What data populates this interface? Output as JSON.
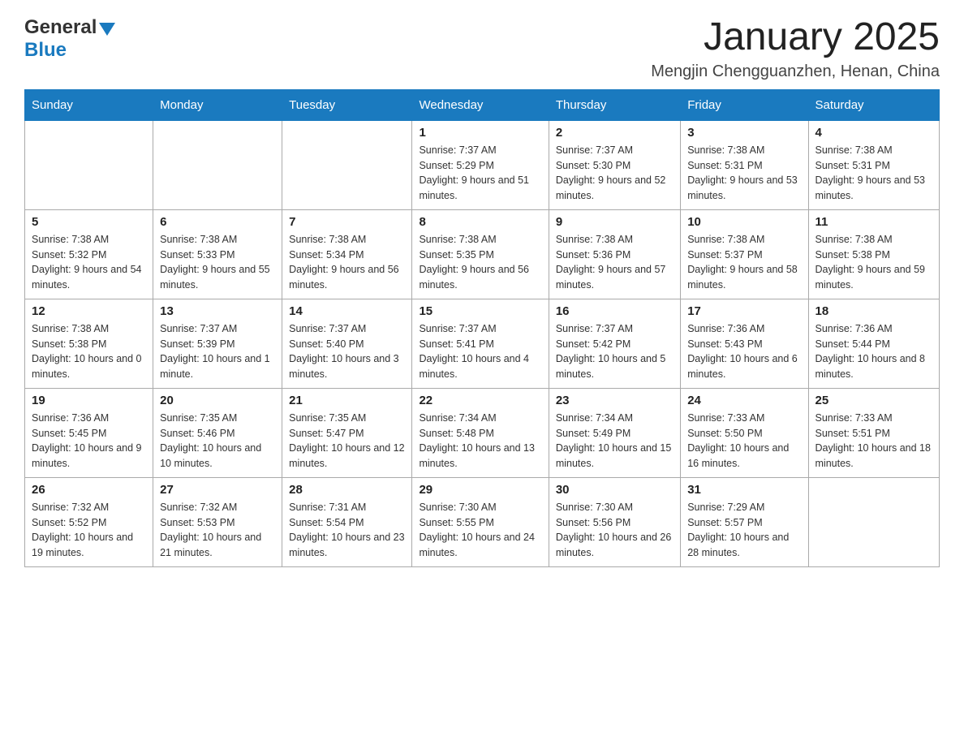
{
  "header": {
    "logo_general": "General",
    "logo_blue": "Blue",
    "month_title": "January 2025",
    "location": "Mengjin Chengguanzhen, Henan, China"
  },
  "days_of_week": [
    "Sunday",
    "Monday",
    "Tuesday",
    "Wednesday",
    "Thursday",
    "Friday",
    "Saturday"
  ],
  "weeks": [
    [
      {
        "day": "",
        "sunrise": "",
        "sunset": "",
        "daylight": ""
      },
      {
        "day": "",
        "sunrise": "",
        "sunset": "",
        "daylight": ""
      },
      {
        "day": "",
        "sunrise": "",
        "sunset": "",
        "daylight": ""
      },
      {
        "day": "1",
        "sunrise": "Sunrise: 7:37 AM",
        "sunset": "Sunset: 5:29 PM",
        "daylight": "Daylight: 9 hours and 51 minutes."
      },
      {
        "day": "2",
        "sunrise": "Sunrise: 7:37 AM",
        "sunset": "Sunset: 5:30 PM",
        "daylight": "Daylight: 9 hours and 52 minutes."
      },
      {
        "day": "3",
        "sunrise": "Sunrise: 7:38 AM",
        "sunset": "Sunset: 5:31 PM",
        "daylight": "Daylight: 9 hours and 53 minutes."
      },
      {
        "day": "4",
        "sunrise": "Sunrise: 7:38 AM",
        "sunset": "Sunset: 5:31 PM",
        "daylight": "Daylight: 9 hours and 53 minutes."
      }
    ],
    [
      {
        "day": "5",
        "sunrise": "Sunrise: 7:38 AM",
        "sunset": "Sunset: 5:32 PM",
        "daylight": "Daylight: 9 hours and 54 minutes."
      },
      {
        "day": "6",
        "sunrise": "Sunrise: 7:38 AM",
        "sunset": "Sunset: 5:33 PM",
        "daylight": "Daylight: 9 hours and 55 minutes."
      },
      {
        "day": "7",
        "sunrise": "Sunrise: 7:38 AM",
        "sunset": "Sunset: 5:34 PM",
        "daylight": "Daylight: 9 hours and 56 minutes."
      },
      {
        "day": "8",
        "sunrise": "Sunrise: 7:38 AM",
        "sunset": "Sunset: 5:35 PM",
        "daylight": "Daylight: 9 hours and 56 minutes."
      },
      {
        "day": "9",
        "sunrise": "Sunrise: 7:38 AM",
        "sunset": "Sunset: 5:36 PM",
        "daylight": "Daylight: 9 hours and 57 minutes."
      },
      {
        "day": "10",
        "sunrise": "Sunrise: 7:38 AM",
        "sunset": "Sunset: 5:37 PM",
        "daylight": "Daylight: 9 hours and 58 minutes."
      },
      {
        "day": "11",
        "sunrise": "Sunrise: 7:38 AM",
        "sunset": "Sunset: 5:38 PM",
        "daylight": "Daylight: 9 hours and 59 minutes."
      }
    ],
    [
      {
        "day": "12",
        "sunrise": "Sunrise: 7:38 AM",
        "sunset": "Sunset: 5:38 PM",
        "daylight": "Daylight: 10 hours and 0 minutes."
      },
      {
        "day": "13",
        "sunrise": "Sunrise: 7:37 AM",
        "sunset": "Sunset: 5:39 PM",
        "daylight": "Daylight: 10 hours and 1 minute."
      },
      {
        "day": "14",
        "sunrise": "Sunrise: 7:37 AM",
        "sunset": "Sunset: 5:40 PM",
        "daylight": "Daylight: 10 hours and 3 minutes."
      },
      {
        "day": "15",
        "sunrise": "Sunrise: 7:37 AM",
        "sunset": "Sunset: 5:41 PM",
        "daylight": "Daylight: 10 hours and 4 minutes."
      },
      {
        "day": "16",
        "sunrise": "Sunrise: 7:37 AM",
        "sunset": "Sunset: 5:42 PM",
        "daylight": "Daylight: 10 hours and 5 minutes."
      },
      {
        "day": "17",
        "sunrise": "Sunrise: 7:36 AM",
        "sunset": "Sunset: 5:43 PM",
        "daylight": "Daylight: 10 hours and 6 minutes."
      },
      {
        "day": "18",
        "sunrise": "Sunrise: 7:36 AM",
        "sunset": "Sunset: 5:44 PM",
        "daylight": "Daylight: 10 hours and 8 minutes."
      }
    ],
    [
      {
        "day": "19",
        "sunrise": "Sunrise: 7:36 AM",
        "sunset": "Sunset: 5:45 PM",
        "daylight": "Daylight: 10 hours and 9 minutes."
      },
      {
        "day": "20",
        "sunrise": "Sunrise: 7:35 AM",
        "sunset": "Sunset: 5:46 PM",
        "daylight": "Daylight: 10 hours and 10 minutes."
      },
      {
        "day": "21",
        "sunrise": "Sunrise: 7:35 AM",
        "sunset": "Sunset: 5:47 PM",
        "daylight": "Daylight: 10 hours and 12 minutes."
      },
      {
        "day": "22",
        "sunrise": "Sunrise: 7:34 AM",
        "sunset": "Sunset: 5:48 PM",
        "daylight": "Daylight: 10 hours and 13 minutes."
      },
      {
        "day": "23",
        "sunrise": "Sunrise: 7:34 AM",
        "sunset": "Sunset: 5:49 PM",
        "daylight": "Daylight: 10 hours and 15 minutes."
      },
      {
        "day": "24",
        "sunrise": "Sunrise: 7:33 AM",
        "sunset": "Sunset: 5:50 PM",
        "daylight": "Daylight: 10 hours and 16 minutes."
      },
      {
        "day": "25",
        "sunrise": "Sunrise: 7:33 AM",
        "sunset": "Sunset: 5:51 PM",
        "daylight": "Daylight: 10 hours and 18 minutes."
      }
    ],
    [
      {
        "day": "26",
        "sunrise": "Sunrise: 7:32 AM",
        "sunset": "Sunset: 5:52 PM",
        "daylight": "Daylight: 10 hours and 19 minutes."
      },
      {
        "day": "27",
        "sunrise": "Sunrise: 7:32 AM",
        "sunset": "Sunset: 5:53 PM",
        "daylight": "Daylight: 10 hours and 21 minutes."
      },
      {
        "day": "28",
        "sunrise": "Sunrise: 7:31 AM",
        "sunset": "Sunset: 5:54 PM",
        "daylight": "Daylight: 10 hours and 23 minutes."
      },
      {
        "day": "29",
        "sunrise": "Sunrise: 7:30 AM",
        "sunset": "Sunset: 5:55 PM",
        "daylight": "Daylight: 10 hours and 24 minutes."
      },
      {
        "day": "30",
        "sunrise": "Sunrise: 7:30 AM",
        "sunset": "Sunset: 5:56 PM",
        "daylight": "Daylight: 10 hours and 26 minutes."
      },
      {
        "day": "31",
        "sunrise": "Sunrise: 7:29 AM",
        "sunset": "Sunset: 5:57 PM",
        "daylight": "Daylight: 10 hours and 28 minutes."
      },
      {
        "day": "",
        "sunrise": "",
        "sunset": "",
        "daylight": ""
      }
    ]
  ]
}
